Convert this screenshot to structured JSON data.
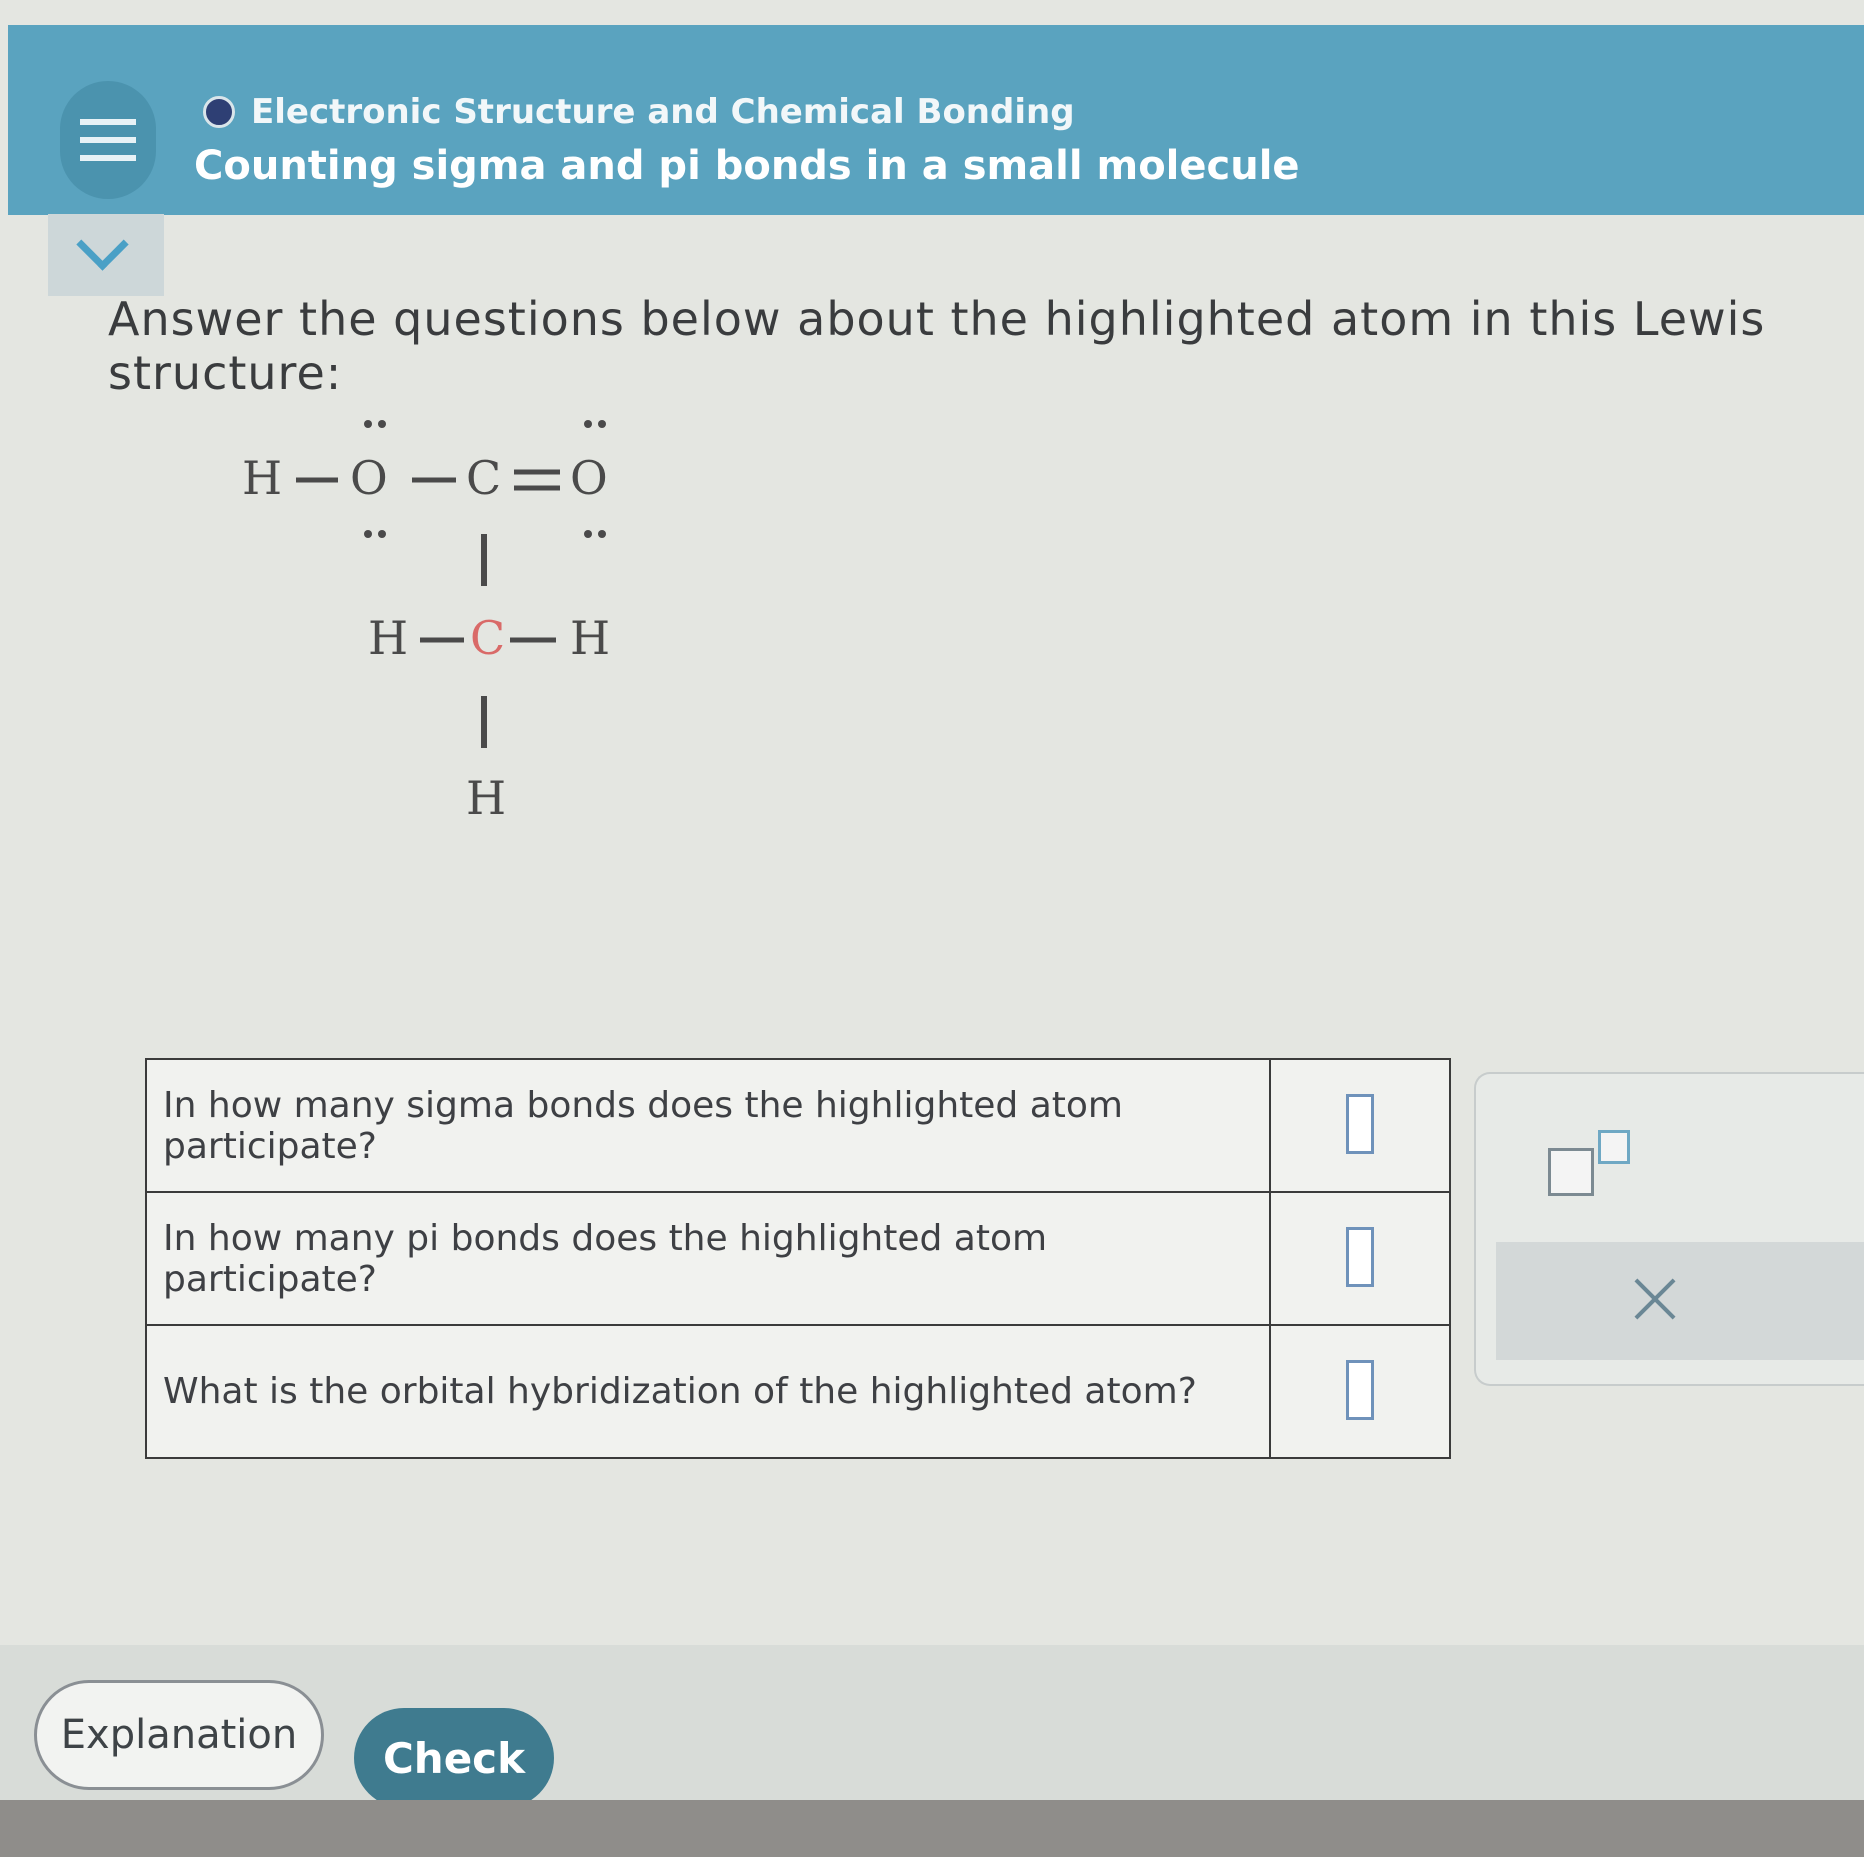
{
  "header": {
    "topic": "Electronic Structure and Chemical Bonding",
    "title": "Counting sigma and pi bonds in a small molecule"
  },
  "instruction": "Answer the questions below about the highlighted atom in this Lewis structure:",
  "lewis_structure": {
    "atoms": {
      "h_left": "H",
      "o_single": "O",
      "c_top": "C",
      "o_double": "O",
      "h_mid_left": "H",
      "c_highlighted": "C",
      "h_mid_right": "H",
      "h_bottom": "H"
    },
    "highlight_color": "#d96a68"
  },
  "questions": [
    {
      "text": "In how many sigma bonds does the highlighted atom participate?",
      "answer": ""
    },
    {
      "text": "In how many pi bonds does the highlighted atom participate?",
      "answer": ""
    },
    {
      "text": "What is the orbital hybridization of the highlighted atom?",
      "answer": ""
    }
  ],
  "tools": {
    "superscript_icon": "superscript-icon",
    "close_icon": "close-icon"
  },
  "buttons": {
    "explanation": "Explanation",
    "check": "Check"
  },
  "colors": {
    "header": "#5aa3bf",
    "check_button": "#3f7b8f",
    "answer_border": "#6f92ba"
  }
}
